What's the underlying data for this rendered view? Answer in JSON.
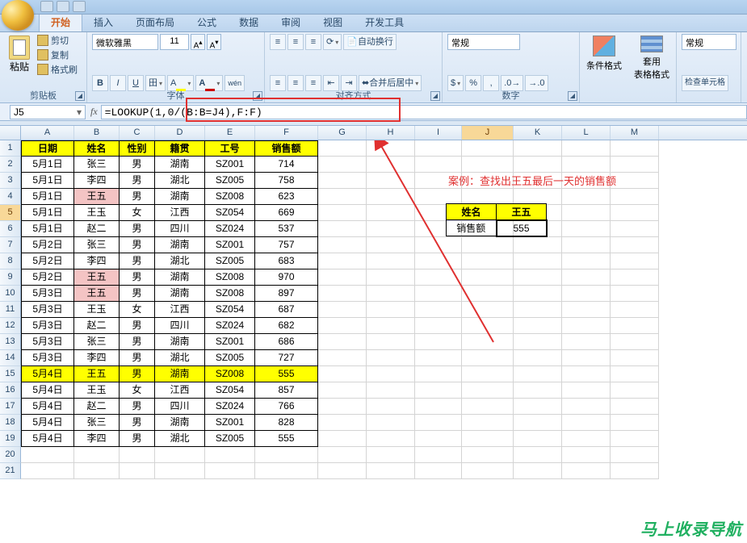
{
  "tabs": [
    "开始",
    "插入",
    "页面布局",
    "公式",
    "数据",
    "审阅",
    "视图",
    "开发工具"
  ],
  "active_tab": 0,
  "clipboard": {
    "paste": "粘贴",
    "cut": "剪切",
    "copy": "复制",
    "fmt": "格式刷",
    "label": "剪贴板"
  },
  "font": {
    "name": "微软雅黑",
    "size": "11",
    "label": "字体",
    "grow": "A",
    "shrink": "A"
  },
  "align": {
    "label": "对齐方式",
    "wrap": "自动换行",
    "merge": "合并后居中"
  },
  "number": {
    "label": "数字",
    "fmt": "常规"
  },
  "styles": {
    "cond": "条件格式",
    "tbl": "套用\n表格格式",
    "numfmt": "常规",
    "check": "检查单元格"
  },
  "name_box": "J5",
  "formula": "=LOOKUP(1,0/(B:B=J4),F:F)",
  "cols": [
    "A",
    "B",
    "C",
    "D",
    "E",
    "F",
    "G",
    "H",
    "I",
    "J",
    "K",
    "L",
    "M"
  ],
  "headers": [
    "日期",
    "姓名",
    "性别",
    "籍贯",
    "工号",
    "销售额"
  ],
  "rows": [
    [
      "5月1日",
      "张三",
      "男",
      "湖南",
      "SZ001",
      "714",
      "",
      "",
      ""
    ],
    [
      "5月1日",
      "李四",
      "男",
      "湖北",
      "SZ005",
      "758",
      "",
      "",
      ""
    ],
    [
      "5月1日",
      "王五",
      "男",
      "湖南",
      "SZ008",
      "623",
      "",
      "pink",
      ""
    ],
    [
      "5月1日",
      "王玉",
      "女",
      "江西",
      "SZ054",
      "669",
      "",
      "",
      ""
    ],
    [
      "5月1日",
      "赵二",
      "男",
      "四川",
      "SZ024",
      "537",
      "",
      "",
      ""
    ],
    [
      "5月2日",
      "张三",
      "男",
      "湖南",
      "SZ001",
      "757",
      "",
      "",
      ""
    ],
    [
      "5月2日",
      "李四",
      "男",
      "湖北",
      "SZ005",
      "683",
      "",
      "",
      ""
    ],
    [
      "5月2日",
      "王五",
      "男",
      "湖南",
      "SZ008",
      "970",
      "",
      "pink",
      ""
    ],
    [
      "5月3日",
      "王五",
      "男",
      "湖南",
      "SZ008",
      "897",
      "",
      "pink",
      ""
    ],
    [
      "5月3日",
      "王玉",
      "女",
      "江西",
      "SZ054",
      "687",
      "",
      "",
      ""
    ],
    [
      "5月3日",
      "赵二",
      "男",
      "四川",
      "SZ024",
      "682",
      "",
      "",
      ""
    ],
    [
      "5月3日",
      "张三",
      "男",
      "湖南",
      "SZ001",
      "686",
      "",
      "",
      ""
    ],
    [
      "5月3日",
      "李四",
      "男",
      "湖北",
      "SZ005",
      "727",
      "",
      "",
      ""
    ],
    [
      "5月4日",
      "王五",
      "男",
      "湖南",
      "SZ008",
      "555",
      "ylw",
      "ylw",
      "ylw"
    ],
    [
      "5月4日",
      "王玉",
      "女",
      "江西",
      "SZ054",
      "857",
      "",
      "",
      ""
    ],
    [
      "5月4日",
      "赵二",
      "男",
      "四川",
      "SZ024",
      "766",
      "",
      "",
      ""
    ],
    [
      "5月4日",
      "张三",
      "男",
      "湖南",
      "SZ001",
      "828",
      "",
      "",
      ""
    ],
    [
      "5月4日",
      "李四",
      "男",
      "湖北",
      "SZ005",
      "555",
      "",
      "",
      ""
    ]
  ],
  "case_text": "案例：查找出王五最后一天的销售额",
  "lookup": {
    "name_lbl": "姓名",
    "name_val": "王五",
    "sales_lbl": "销售额",
    "sales_val": "555"
  },
  "watermark": "马上收录导航"
}
